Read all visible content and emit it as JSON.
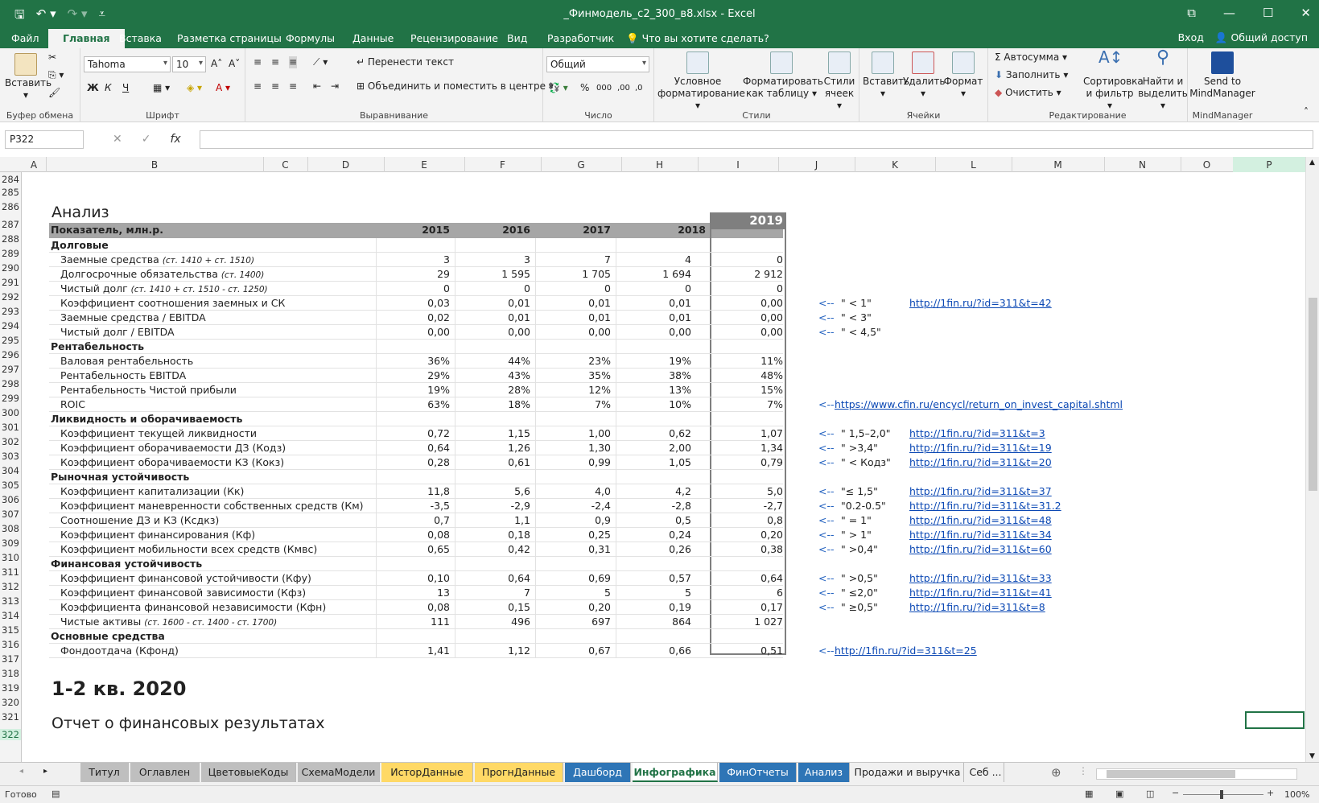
{
  "window": {
    "title": "_Финмодель_c2_300_в8.xlsx - Excel"
  },
  "menu": {
    "tabs": [
      "Файл",
      "Главная",
      "Вставка",
      "Разметка страницы",
      "Формулы",
      "Данные",
      "Рецензирование",
      "Вид",
      "Разработчик"
    ],
    "tell_me": "Что вы хотите сделать?",
    "signin": "Вход",
    "share": "Общий доступ"
  },
  "ribbon": {
    "paste": "Вставить",
    "clipboard": "Буфер обмена",
    "font_name": "Tahoma",
    "font_size": "10",
    "bold": "Ж",
    "italic": "К",
    "underline": "Ч",
    "font": "Шрифт",
    "wrap": "Перенести текст",
    "merge": "Объединить и поместить в центре",
    "alignment": "Выравнивание",
    "number_format": "Общий",
    "number": "Число",
    "cond_format": "Условное форматирование",
    "format_table": "Форматировать как таблицу",
    "cell_styles": "Стили ячеек",
    "styles": "Стили",
    "insert": "Вставить",
    "delete": "Удалить",
    "format": "Формат",
    "cells": "Ячейки",
    "autosum": "Автосумма",
    "fill": "Заполнить",
    "clear": "Очистить",
    "sort": "Сортировка и фильтр",
    "find": "Найти и выделить",
    "editing": "Редактирование",
    "send_mm": "Send to MindManager",
    "mindmanager": "MindManager"
  },
  "formula": {
    "namebox": "P322",
    "value": ""
  },
  "columns": [
    "A",
    "B",
    "C",
    "D",
    "E",
    "F",
    "G",
    "H",
    "I",
    "J",
    "K",
    "L",
    "M",
    "N",
    "O",
    "P"
  ],
  "rows": [
    "284",
    "285",
    "286",
    "287",
    "288",
    "289",
    "290",
    "291",
    "292",
    "293",
    "294",
    "295",
    "296",
    "297",
    "298",
    "299",
    "300",
    "301",
    "302",
    "303",
    "304",
    "305",
    "306",
    "307",
    "308",
    "309",
    "310",
    "311",
    "312",
    "313",
    "314",
    "315",
    "316",
    "317",
    "318",
    "319",
    "320",
    "321",
    "322"
  ],
  "sheet": {
    "heading": "Анализ",
    "header": {
      "label": "Показатель, млн.р.",
      "years": [
        "2015",
        "2016",
        "2017",
        "2018",
        "2019"
      ]
    },
    "lines": [
      {
        "t": "section",
        "label": "Долговые"
      },
      {
        "label": "Заемные средства",
        "note": "(ст. 1410 + ст. 1510)",
        "v": [
          "3",
          "3",
          "7",
          "4",
          "0"
        ]
      },
      {
        "label": "Долгосрочные обязательства",
        "note": "(ст. 1400)",
        "v": [
          "29",
          "1 595",
          "1 705",
          "1 694",
          "2 912"
        ]
      },
      {
        "label": "Чистый долг",
        "note": "(ст. 1410 + ст. 1510 - ст. 1250)",
        "v": [
          "0",
          "0",
          "0",
          "0",
          "0"
        ]
      },
      {
        "label": "Коэффициент соотношения заемных и СК",
        "v": [
          "0,03",
          "0,01",
          "0,01",
          "0,01",
          "0,00"
        ],
        "cond": "\" < 1\"",
        "link": "http://1fin.ru/?id=311&t=42"
      },
      {
        "label": "Заемные средства / EBITDA",
        "v": [
          "0,02",
          "0,01",
          "0,01",
          "0,01",
          "0,00"
        ],
        "cond": "\" < 3\""
      },
      {
        "label": "Чистый долг / EBITDA",
        "v": [
          "0,00",
          "0,00",
          "0,00",
          "0,00",
          "0,00"
        ],
        "cond": "\" < 4,5\""
      },
      {
        "t": "section",
        "label": "Рентабельность"
      },
      {
        "label": "Валовая рентабельность",
        "v": [
          "36%",
          "44%",
          "23%",
          "19%",
          "11%"
        ]
      },
      {
        "label": "Рентабельность EBITDA",
        "v": [
          "29%",
          "43%",
          "35%",
          "38%",
          "48%"
        ]
      },
      {
        "label": "Рентабельность Чистой прибыли",
        "v": [
          "19%",
          "28%",
          "12%",
          "13%",
          "15%"
        ]
      },
      {
        "label": "ROIC",
        "v": [
          "63%",
          "18%",
          "7%",
          "10%",
          "7%"
        ],
        "link_near": "https://www.cfin.ru/encycl/return_on_invest_capital.shtml"
      },
      {
        "t": "section",
        "label": "Ликвидность и оборачиваемость"
      },
      {
        "label": "Коэффициент текущей ликвидности",
        "v": [
          "0,72",
          "1,15",
          "1,00",
          "0,62",
          "1,07"
        ],
        "cond": "\" 1,5–2,0\"",
        "link": "http://1fin.ru/?id=311&t=3"
      },
      {
        "label": "Коэффициент оборачиваемости ДЗ (Кодз)",
        "v": [
          "0,64",
          "1,26",
          "1,30",
          "2,00",
          "1,34"
        ],
        "cond": "\" >3,4\"",
        "link": "http://1fin.ru/?id=311&t=19"
      },
      {
        "label": "Коэффициент оборачиваемости КЗ (Кокз)",
        "v": [
          "0,28",
          "0,61",
          "0,99",
          "1,05",
          "0,79"
        ],
        "cond": "\" < Кодз\"",
        "link": "http://1fin.ru/?id=311&t=20"
      },
      {
        "t": "section",
        "label": "Рыночная устойчивость"
      },
      {
        "label": "Коэффициент капитализации (Кк)",
        "v": [
          "11,8",
          "5,6",
          "4,0",
          "4,2",
          "5,0"
        ],
        "cond": "\"≤ 1,5\"",
        "link": "http://1fin.ru/?id=311&t=37"
      },
      {
        "label": "Коэффициент маневренности собственных средств (Км)",
        "v": [
          "-3,5",
          "-2,9",
          "-2,4",
          "-2,8",
          "-2,7"
        ],
        "cond": "\"0.2-0.5\"",
        "link": "http://1fin.ru/?id=311&t=31.2"
      },
      {
        "label": "Соотношение ДЗ и КЗ (Ксдкз)",
        "v": [
          "0,7",
          "1,1",
          "0,9",
          "0,5",
          "0,8"
        ],
        "cond": "\" = 1\"",
        "link": "http://1fin.ru/?id=311&t=48"
      },
      {
        "label": "Коэффициент финансирования (Кф)",
        "v": [
          "0,08",
          "0,18",
          "0,25",
          "0,24",
          "0,20"
        ],
        "cond": "\" > 1\"",
        "link": "http://1fin.ru/?id=311&t=34"
      },
      {
        "label": "Коэффициент мобильности всех средств (Кмвс)",
        "v": [
          "0,65",
          "0,42",
          "0,31",
          "0,26",
          "0,38"
        ],
        "cond": "\" >0,4\"",
        "link": "http://1fin.ru/?id=311&t=60"
      },
      {
        "t": "section",
        "label": "Финансовая устойчивость"
      },
      {
        "label": "Коэффициент финансовой устойчивости (Кфу)",
        "v": [
          "0,10",
          "0,64",
          "0,69",
          "0,57",
          "0,64"
        ],
        "cond": "\" >0,5\"",
        "link": "http://1fin.ru/?id=311&t=33"
      },
      {
        "label": "Коэффициент финансовой зависимости (Кфз)",
        "v": [
          "13",
          "7",
          "5",
          "5",
          "6"
        ],
        "cond": "\" ≤2,0\"",
        "link": "http://1fin.ru/?id=311&t=41"
      },
      {
        "label": "Коэффициента финансовой независимости (Кфн)",
        "v": [
          "0,08",
          "0,15",
          "0,20",
          "0,19",
          "0,17"
        ],
        "cond": "\" ≥0,5\"",
        "link": "http://1fin.ru/?id=311&t=8"
      },
      {
        "label": "Чистые активы",
        "note": "(ст. 1600 - ст. 1400 - ст. 1700)",
        "v": [
          "111",
          "496",
          "697",
          "864",
          "1 027"
        ]
      },
      {
        "t": "section",
        "label": "Основные средства"
      },
      {
        "label": "Фондоотдача (Кфонд)",
        "v": [
          "1,41",
          "1,12",
          "0,67",
          "0,66",
          "0,51"
        ],
        "link_near": "http://1fin.ru/?id=311&t=25"
      }
    ],
    "arrow": "<--",
    "period": "1-2 кв. 2020",
    "report": "Отчет о финансовых результатах"
  },
  "sheet_tabs": [
    {
      "name": "Титул",
      "color": "#bfbfbf"
    },
    {
      "name": "Оглавлен",
      "color": "#bfbfbf"
    },
    {
      "name": "ЦветовыеКоды",
      "color": "#bfbfbf"
    },
    {
      "name": "СхемаМодели",
      "color": "#bfbfbf"
    },
    {
      "name": "ИсторДанные",
      "color": "#ffd966"
    },
    {
      "name": "ПрогнДанные",
      "color": "#ffd966"
    },
    {
      "name": "Дашборд",
      "color": "#2e75b6"
    },
    {
      "name": "Инфографика",
      "color": "#ffffff"
    },
    {
      "name": "ФинОтчеты",
      "color": "#2e75b6"
    },
    {
      "name": "Анализ",
      "color": "#2e75b6"
    },
    {
      "name": "Продажи и выручка",
      "color": "#f0f0f0"
    },
    {
      "name": "Себ ...",
      "color": "#f0f0f0"
    }
  ],
  "status": {
    "ready": "Готово",
    "zoom": "100%"
  }
}
